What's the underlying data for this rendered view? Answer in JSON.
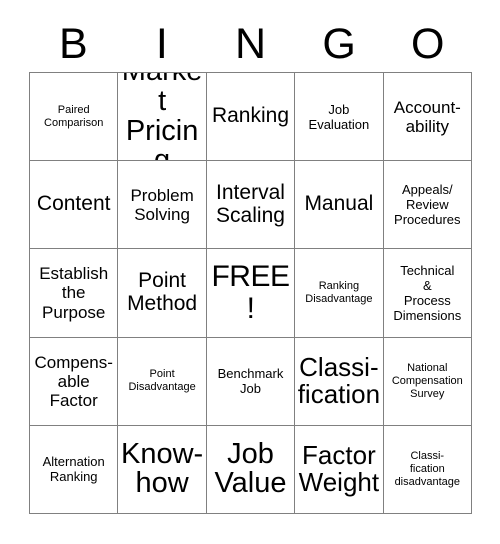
{
  "card": {
    "title_letters": [
      "B",
      "I",
      "N",
      "G",
      "O"
    ],
    "free_space_label": "FREE!",
    "grid": {
      "columns": 5,
      "rows": 5,
      "cells": [
        {
          "text": "Paired\nComparison",
          "size": "s-xs"
        },
        {
          "text": "Market\nPricing",
          "size": "s-xxl"
        },
        {
          "text": "Ranking",
          "size": "s-lg"
        },
        {
          "text": "Job\nEvaluation",
          "size": "s-sm"
        },
        {
          "text": "Account-\nability",
          "size": "s-md"
        },
        {
          "text": "Content",
          "size": "s-lg"
        },
        {
          "text": "Problem\nSolving",
          "size": "s-md"
        },
        {
          "text": "Interval\nScaling",
          "size": "s-lg"
        },
        {
          "text": "Manual",
          "size": "s-lg"
        },
        {
          "text": "Appeals/\nReview\nProcedures",
          "size": "s-sm"
        },
        {
          "text": "Establish\nthe\nPurpose",
          "size": "s-md"
        },
        {
          "text": "Point\nMethod",
          "size": "s-lg"
        },
        {
          "text": "FREE!",
          "size": "free"
        },
        {
          "text": "Ranking\nDisadvantage",
          "size": "s-xs"
        },
        {
          "text": "Technical\n&\nProcess\nDimensions",
          "size": "s-sm"
        },
        {
          "text": "Compens-\nable\nFactor",
          "size": "s-md"
        },
        {
          "text": "Point\nDisadvantage",
          "size": "s-xs"
        },
        {
          "text": "Benchmark\nJob",
          "size": "s-sm"
        },
        {
          "text": "Classi-\nfication",
          "size": "s-xl"
        },
        {
          "text": "National\nCompensation\nSurvey",
          "size": "s-xs"
        },
        {
          "text": "Alternation\nRanking",
          "size": "s-sm"
        },
        {
          "text": "Know-\nhow",
          "size": "s-xxl"
        },
        {
          "text": "Job\nValue",
          "size": "s-xxl"
        },
        {
          "text": "Factor\nWeight",
          "size": "s-xl"
        },
        {
          "text": "Classi-\nfication\ndisadvantage",
          "size": "s-xs"
        }
      ]
    },
    "colors": {
      "background": "#ffffff",
      "text": "#000000",
      "grid_line": "#808080"
    }
  }
}
